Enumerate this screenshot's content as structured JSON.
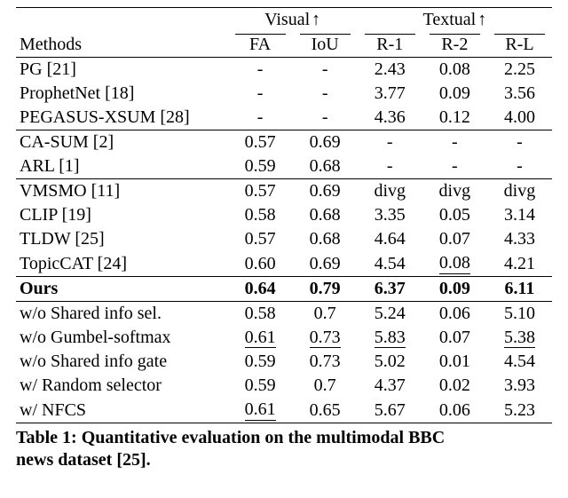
{
  "header": {
    "methods": "Methods",
    "visual": "Visual",
    "visual_arrow": "↑",
    "textual": "Textual",
    "textual_arrow": "↑",
    "fa": "FA",
    "iou": "IoU",
    "r1": "R-1",
    "r2": "R-2",
    "rl": "R-L"
  },
  "chart_data": {
    "type": "table",
    "title": "Table 1: Quantitative evaluation on the multimodal BBC news dataset [25].",
    "column_groups": [
      "",
      "Visual ↑",
      "Visual ↑",
      "Textual ↑",
      "Textual ↑",
      "Textual ↑"
    ],
    "columns": [
      "Methods",
      "FA",
      "IoU",
      "R-1",
      "R-2",
      "R-L"
    ],
    "rows": [
      {
        "method": "PG [21]",
        "fa": "-",
        "iou": "-",
        "r1": "2.43",
        "r2": "0.08",
        "rl": "2.25"
      },
      {
        "method": "ProphetNet [18]",
        "fa": "-",
        "iou": "-",
        "r1": "3.77",
        "r2": "0.09",
        "rl": "3.56"
      },
      {
        "method": "PEGASUS-XSUM [28]",
        "fa": "-",
        "iou": "-",
        "r1": "4.36",
        "r2": "0.12",
        "rl": "4.00"
      },
      {
        "method": "CA-SUM [2]",
        "fa": "0.57",
        "iou": "0.69",
        "r1": "-",
        "r2": "-",
        "rl": "-"
      },
      {
        "method": "ARL [1]",
        "fa": "0.59",
        "iou": "0.68",
        "r1": "-",
        "r2": "-",
        "rl": "-"
      },
      {
        "method": "VMSMO [11]",
        "fa": "0.57",
        "iou": "0.69",
        "r1": "divg",
        "r2": "divg",
        "rl": "divg"
      },
      {
        "method": "CLIP [19]",
        "fa": "0.58",
        "iou": "0.68",
        "r1": "3.35",
        "r2": "0.05",
        "rl": "3.14"
      },
      {
        "method": "TLDW [25]",
        "fa": "0.57",
        "iou": "0.68",
        "r1": "4.64",
        "r2": "0.07",
        "rl": "4.33"
      },
      {
        "method": "TopicCAT [24]",
        "fa": "0.60",
        "iou": "0.69",
        "r1": "4.54",
        "r2": "0.08",
        "rl": "4.21"
      },
      {
        "method": "Ours",
        "fa": "0.64",
        "iou": "0.79",
        "r1": "6.37",
        "r2": "0.09",
        "rl": "6.11"
      },
      {
        "method": "w/o Shared info sel.",
        "fa": "0.58",
        "iou": "0.7",
        "r1": "5.24",
        "r2": "0.06",
        "rl": "5.10"
      },
      {
        "method": "w/o Gumbel-softmax",
        "fa": "0.61",
        "iou": "0.73",
        "r1": "5.83",
        "r2": "0.07",
        "rl": "5.38"
      },
      {
        "method": "w/o Shared info gate",
        "fa": "0.59",
        "iou": "0.73",
        "r1": "5.02",
        "r2": "0.01",
        "rl": "4.54"
      },
      {
        "method": "w/ Random selector",
        "fa": "0.59",
        "iou": "0.7",
        "r1": "4.37",
        "r2": "0.02",
        "rl": "3.93"
      },
      {
        "method": "w/ NFCS",
        "fa": "0.61",
        "iou": "0.65",
        "r1": "5.67",
        "r2": "0.06",
        "rl": "5.23"
      }
    ],
    "bold_rows": [
      "Ours"
    ],
    "underline_cells": {
      "TopicCAT [24]": [
        "r2"
      ],
      "w/o Gumbel-softmax": [
        "fa",
        "iou",
        "r1",
        "rl"
      ],
      "w/ NFCS": [
        "fa"
      ]
    },
    "section_rules_before": [
      "CA-SUM [2]",
      "VMSMO [11]",
      "Ours",
      "w/o Shared info sel."
    ],
    "bottom_rule_after": "w/ NFCS"
  },
  "caption_prefix": "Table 1: Quantitative evaluation on the multimodal BBC",
  "caption_suffix": "news dataset [25]."
}
